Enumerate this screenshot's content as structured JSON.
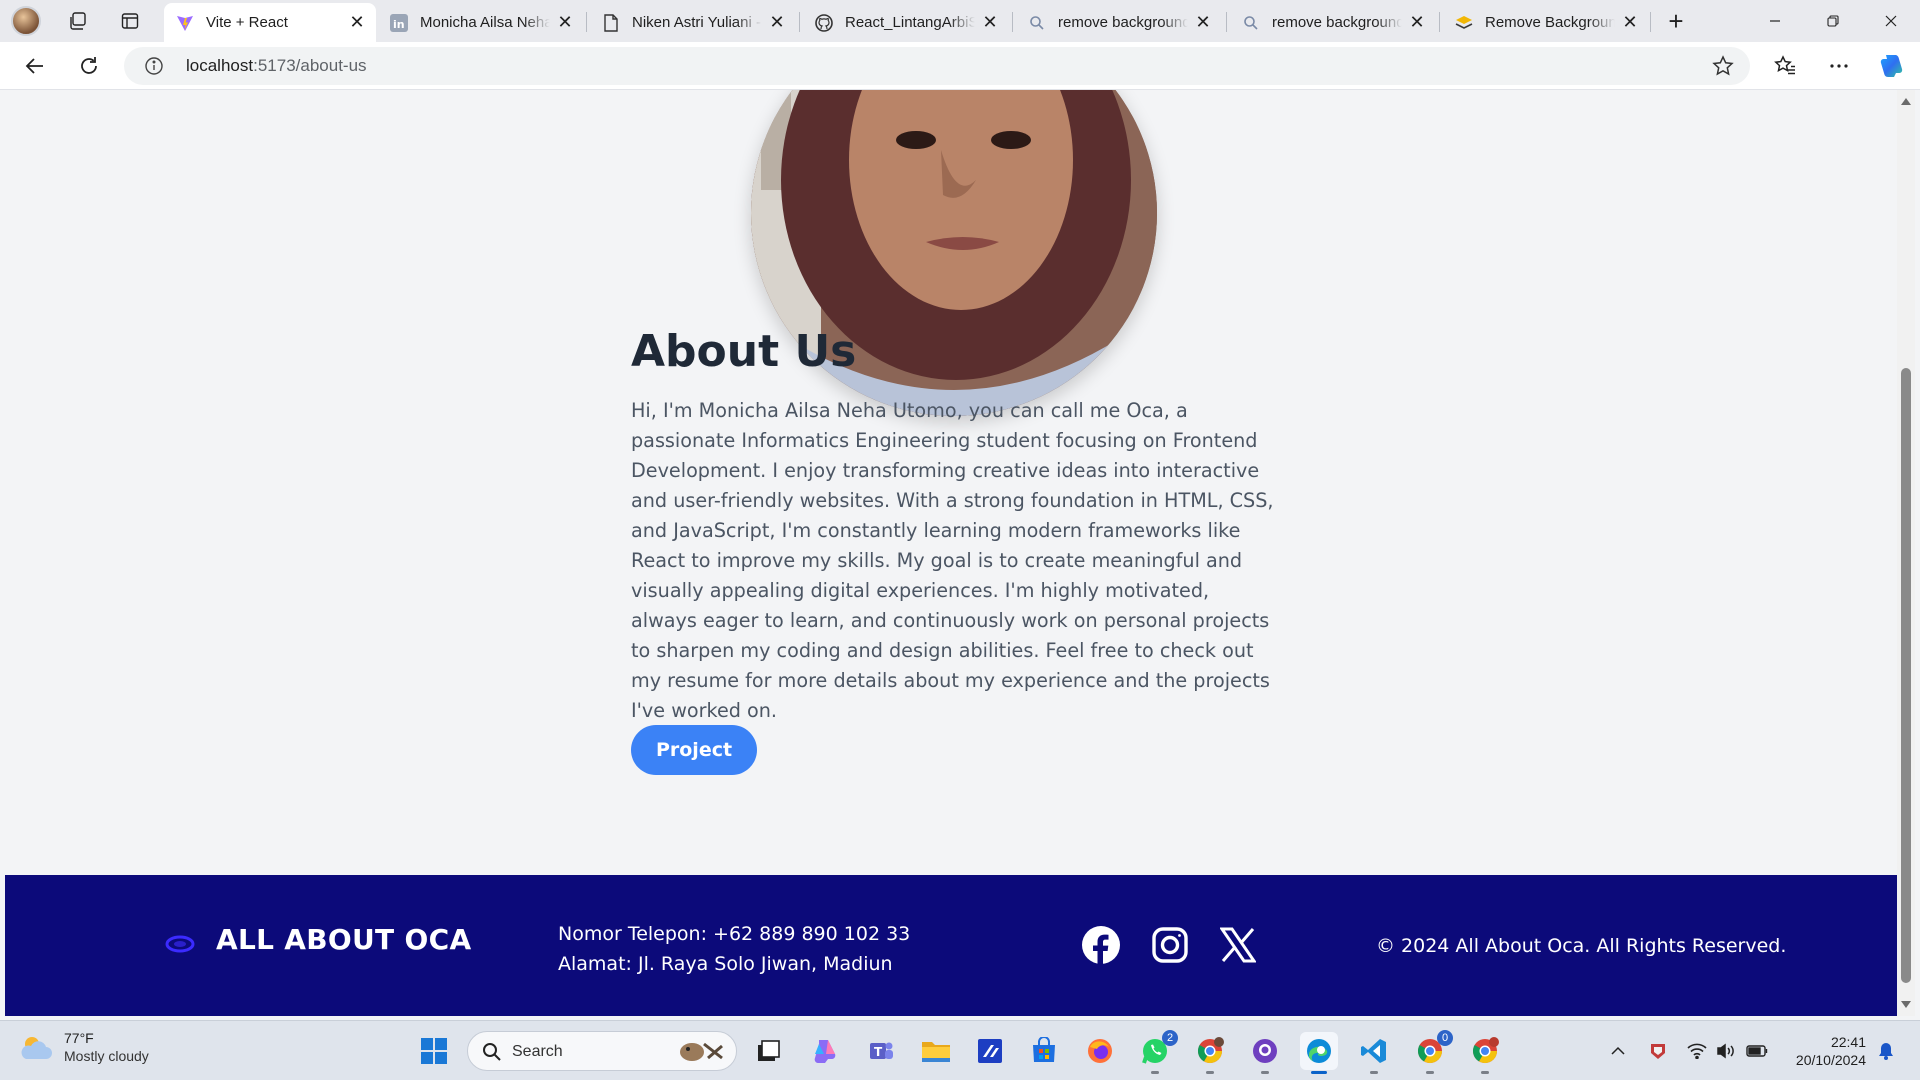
{
  "browser": {
    "tabs": [
      {
        "title": "Vite + React",
        "favicon": "vite-icon",
        "active": true
      },
      {
        "title": "Monicha Ailsa Neha",
        "favicon": "linkedin-icon"
      },
      {
        "title": "Niken Astri Yuliani -",
        "favicon": "document-icon"
      },
      {
        "title": "React_LintangArbiSu",
        "favicon": "github-icon"
      },
      {
        "title": "remove background",
        "favicon": "search-icon"
      },
      {
        "title": "remove background",
        "favicon": "search-icon"
      },
      {
        "title": "Remove Background",
        "favicon": "removebg-icon"
      }
    ],
    "address": {
      "host": "localhost",
      "path": ":5173/about-us"
    }
  },
  "page": {
    "about": {
      "title": "About Us",
      "body": "Hi, I'm Monicha Ailsa Neha Utomo, you can call me Oca, a passionate Informatics Engineering student focusing on Frontend Development. I enjoy transforming creative ideas into interactive and user-friendly websites. With a strong foundation in HTML, CSS, and JavaScript, I'm constantly learning modern frameworks like React to improve my skills. My goal is to create meaningful and visually appealing digital experiences. I'm highly motivated, always eager to learn, and continuously work on personal projects to sharpen my coding and design abilities. Feel free to check out my resume for more details about my experience and the projects I've worked on.",
      "button_label": "Project"
    },
    "footer": {
      "brand": "ALL ABOUT OCA",
      "phone": "Nomor Telepon: +62 889 890 102 33",
      "address": "Alamat: Jl. Raya Solo Jiwan, Madiun",
      "socials": [
        "facebook-icon",
        "instagram-icon",
        "x-icon"
      ],
      "copyright": "© 2024 All About Oca. All Rights Reserved.",
      "bg_color": "#0c0a7a"
    },
    "accent_color": "#3b82f6"
  },
  "taskbar": {
    "weather": {
      "temp": "77°F",
      "condition": "Mostly cloudy"
    },
    "search_placeholder": "Search",
    "badges": {
      "whatsapp": "2",
      "chrome2": "0"
    },
    "clock": {
      "time": "22:41",
      "date": "20/10/2024"
    }
  }
}
